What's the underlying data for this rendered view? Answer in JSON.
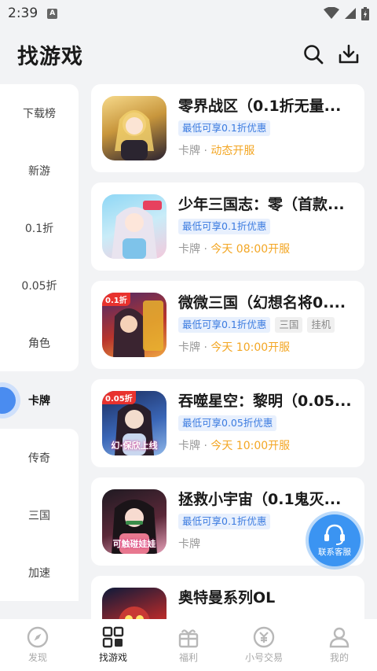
{
  "status_bar": {
    "time": "2:39",
    "notification": "A"
  },
  "header": {
    "title": "找游戏",
    "search_icon": "search-icon",
    "download_icon": "download-icon"
  },
  "sidebar": {
    "items": [
      {
        "label": "下载榜"
      },
      {
        "label": "新游"
      },
      {
        "label": "0.1折"
      },
      {
        "label": "0.05折"
      },
      {
        "label": "角色"
      },
      {
        "label": "卡牌",
        "active": true
      },
      {
        "label": "传奇"
      },
      {
        "label": "三国"
      },
      {
        "label": "加速"
      }
    ]
  },
  "games": [
    {
      "name": "零界战区（0.1折无量...",
      "discount": "最低可享0.1折优惠",
      "tags": [],
      "category": "卡牌",
      "open": "动态开服"
    },
    {
      "name": "少年三国志：零（首款...",
      "discount": "最低可享0.1折优惠",
      "tags": [],
      "category": "卡牌",
      "open": "今天 08:00开服"
    },
    {
      "name": "微微三国（幻想名将0....",
      "discount": "最低可享0.1折优惠",
      "tags": [
        "三国",
        "挂机"
      ],
      "category": "卡牌",
      "open": "今天 10:00开服",
      "icon_badge": "0.1折"
    },
    {
      "name": "吞噬星空：黎明（0.05...",
      "discount": "最低可享0.05折优惠",
      "tags": [],
      "category": "卡牌",
      "open": "今天 10:00开服",
      "icon_badge": "0.05折",
      "icon_caption": "幻·保欣上线"
    },
    {
      "name": "拯救小宇宙（0.1鬼灭...",
      "discount": "最低可享0.1折优惠",
      "tags": [],
      "category": "卡牌",
      "open": "",
      "icon_caption": "可触碰娃娃"
    },
    {
      "name": "奥特曼系列OL",
      "discount": "",
      "tags": [],
      "category": "",
      "open": ""
    }
  ],
  "customer_service": {
    "label": "联系客服"
  },
  "bottom_nav": [
    {
      "label": "发现",
      "icon": "compass-icon"
    },
    {
      "label": "找游戏",
      "icon": "grid-icon",
      "active": true
    },
    {
      "label": "福利",
      "icon": "gift-icon"
    },
    {
      "label": "小号交易",
      "icon": "trade-icon"
    },
    {
      "label": "我的",
      "icon": "user-icon"
    }
  ],
  "colors": {
    "accent": "#3b7be0",
    "open_time": "#f3a623",
    "service": "#3b94f2"
  }
}
